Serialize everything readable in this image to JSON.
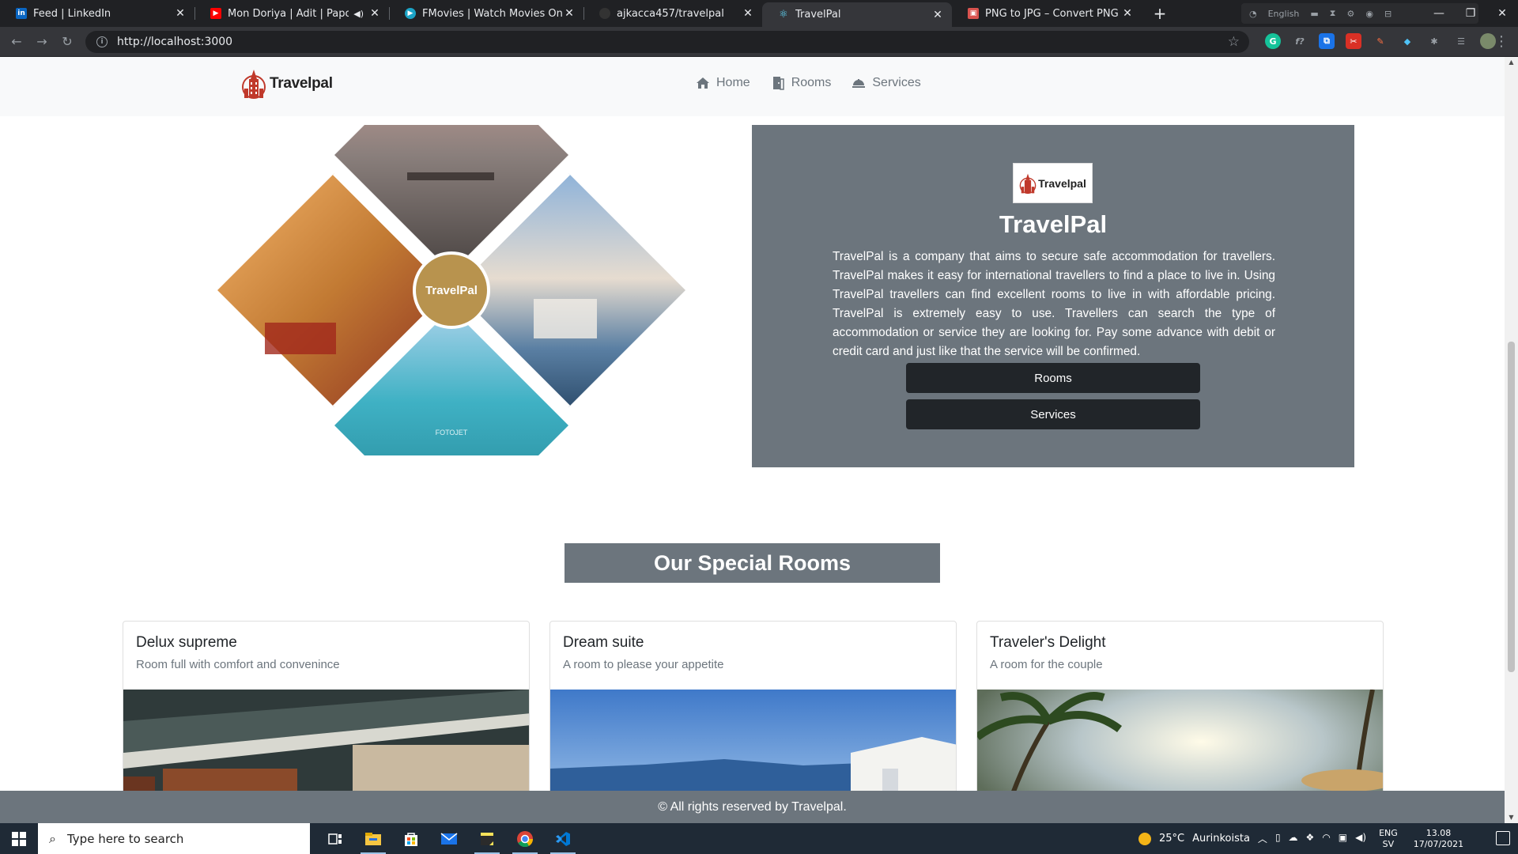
{
  "browser": {
    "tabs": [
      {
        "title": "Feed | LinkedIn",
        "favicon": "linkedin-icon",
        "color": "#0a66c2",
        "glyph": "in"
      },
      {
        "title": "Mon Doriya | Adit | Papon | D",
        "favicon": "youtube-icon",
        "color": "#ff0000",
        "glyph": "▶"
      },
      {
        "title": "FMovies | Watch Movies Online F",
        "favicon": "fmovies-icon",
        "color": "#1ba3c6",
        "glyph": "▶"
      },
      {
        "title": "ajkacca457/travelpal",
        "favicon": "github-icon",
        "color": "#333333",
        "glyph": "●"
      },
      {
        "title": "TravelPal",
        "favicon": "react-icon",
        "color": "#35363a",
        "glyph": "⚛"
      },
      {
        "title": "PNG to JPG – Convert PNG to JP",
        "favicon": "converter-icon",
        "color": "#d9534f",
        "glyph": "▣"
      }
    ],
    "active_tab": 4,
    "url": "http://localhost:3000",
    "ext_label": "English"
  },
  "site": {
    "brand": "Travelpal",
    "nav": {
      "home": "Home",
      "rooms": "Rooms",
      "services": "Services"
    },
    "hero": {
      "collage_center": "TravelPal",
      "collage_watermark": "FOTOJET",
      "logo_text": "Travelpal",
      "title": "TravelPal",
      "description": "TravelPal is a company that aims to secure safe accommodation for travellers. TravelPal makes it easy for international travellers to find a place to live in. Using TravelPal travellers can find excellent rooms to live in with affordable pricing. TravelPal is extremely easy to use. Travellers can search the type of accommodation or service they are looking for. Pay some advance with debit or credit card and just like that the service will be confirmed.",
      "rooms_button": "Rooms",
      "services_button": "Services"
    },
    "special_rooms": {
      "heading": "Our Special Rooms",
      "rooms": [
        {
          "title": "Delux supreme",
          "subtitle": "Room full with comfort and convenince"
        },
        {
          "title": "Dream suite",
          "subtitle": "A room to please your appetite"
        },
        {
          "title": "Traveler's Delight",
          "subtitle": "A room for the couple"
        }
      ]
    },
    "footer": "© All rights reserved by Travelpal."
  },
  "taskbar": {
    "search_placeholder": "Type here to search",
    "temperature": "25°C",
    "weather": "Aurinkoista",
    "lang_primary": "ENG",
    "lang_secondary": "SV",
    "time": "13.08",
    "date": "17/07/2021"
  },
  "colors": {
    "navbar_bg": "#f8f9fa",
    "card_bg": "#6c757d",
    "button_dark": "#212529",
    "brand_red": "#c0392b"
  }
}
